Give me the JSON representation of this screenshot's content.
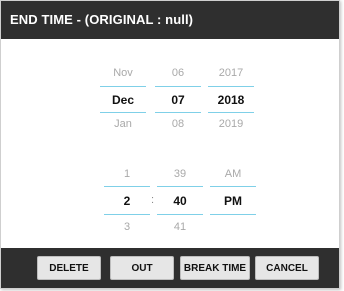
{
  "dialog": {
    "title": "END TIME - (ORIGINAL : null)"
  },
  "date_picker": {
    "month": {
      "prev": "Nov",
      "selected": "Dec",
      "next": "Jan"
    },
    "day": {
      "prev": "06",
      "selected": "07",
      "next": "08"
    },
    "year": {
      "prev": "2017",
      "selected": "2018",
      "next": "2019"
    }
  },
  "time_picker": {
    "hour": {
      "prev": "1",
      "selected": "2",
      "next": "3"
    },
    "separator": ":",
    "minute": {
      "prev": "39",
      "selected": "40",
      "next": "41"
    },
    "ampm": {
      "prev": "AM",
      "selected": "PM",
      "next": ""
    }
  },
  "buttons": {
    "delete": "DELETE",
    "out": "OUT",
    "break_time": "BREAK TIME",
    "cancel": "CANCEL"
  },
  "colors": {
    "title_bar": "#2f2f2f",
    "picker_rule": "#7fd0e8",
    "button_face": "#e6e6e6"
  }
}
